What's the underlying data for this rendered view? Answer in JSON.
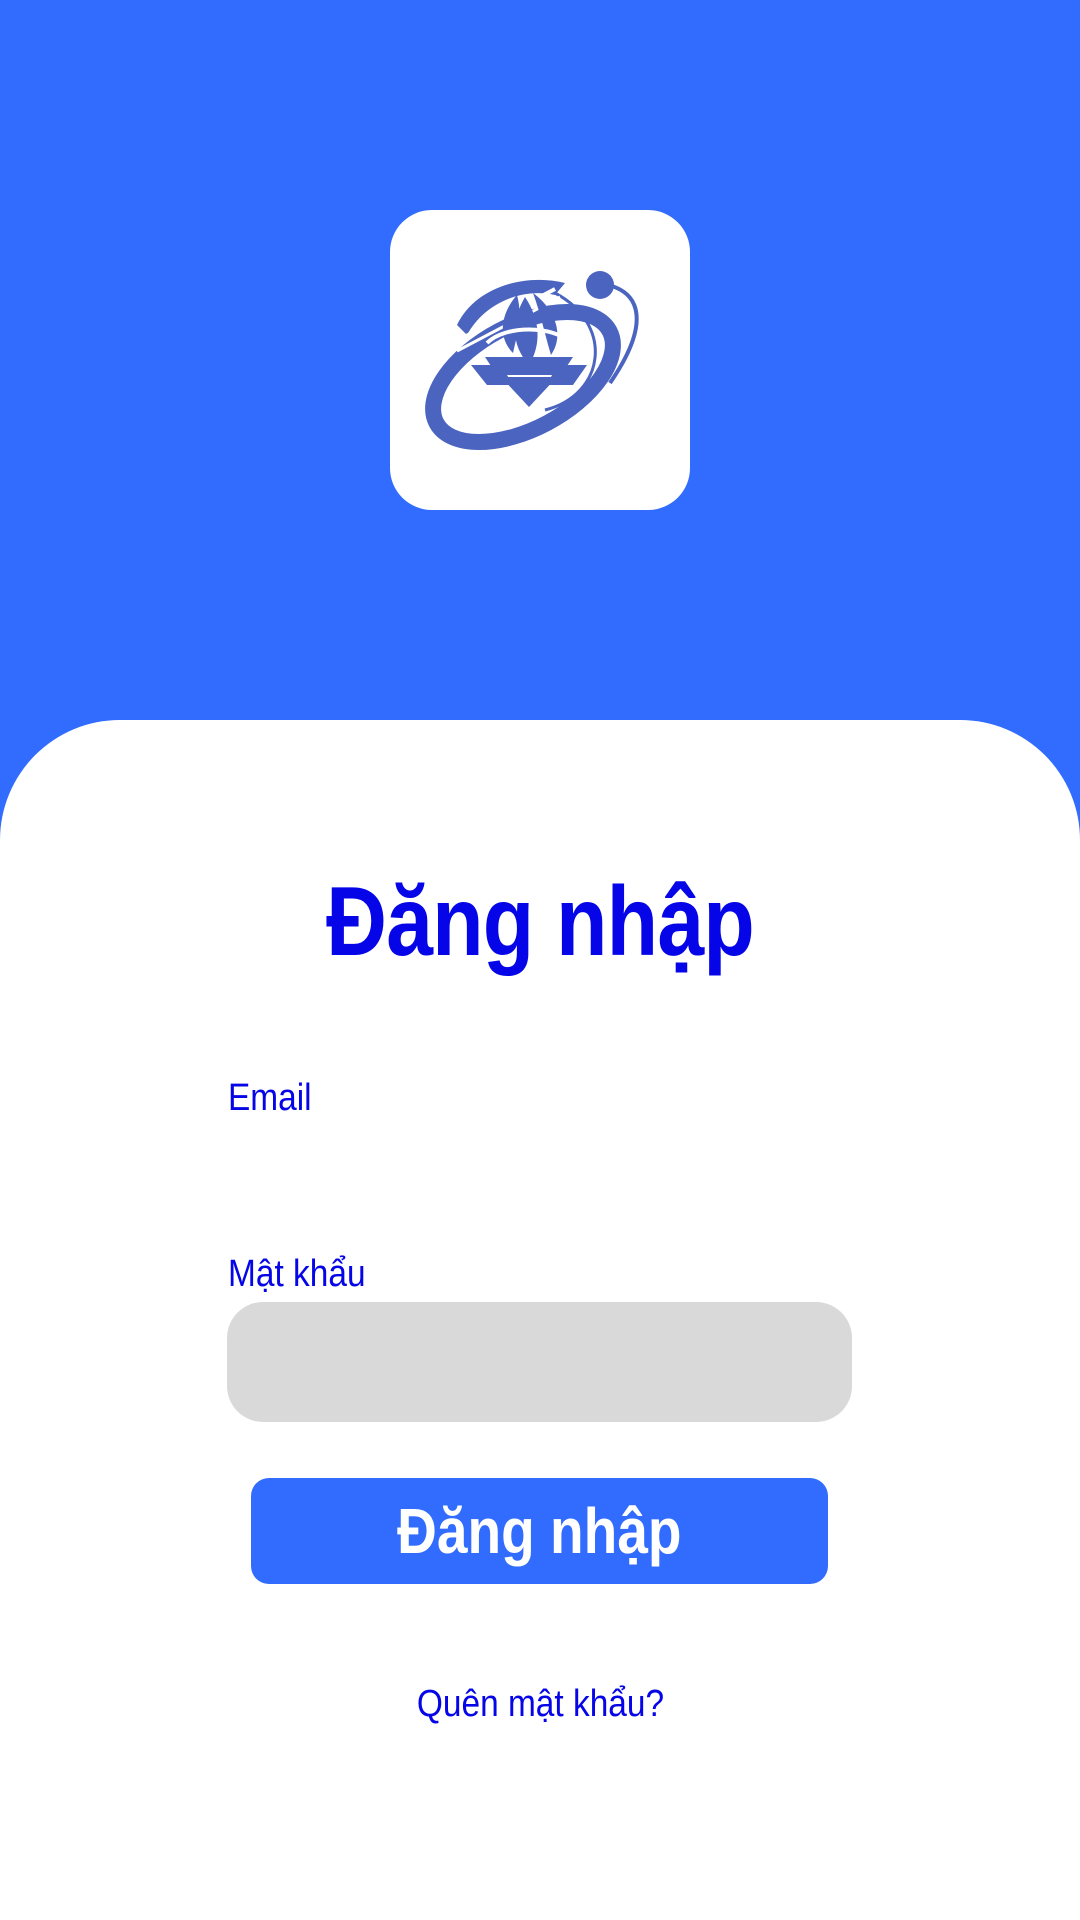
{
  "colors": {
    "primary": "#316cff",
    "text_accent": "#0505e8",
    "input_fill": "#d9d9d9",
    "logo": "#4a64bf"
  },
  "logo": {
    "icon": "university-logo-icon"
  },
  "login": {
    "title": "Đăng nhập",
    "email_label": "Email",
    "email_value": "",
    "password_label": "Mật khẩu",
    "password_value": "",
    "submit_label": "Đăng nhập",
    "forgot_label": "Quên mật khẩu?"
  }
}
